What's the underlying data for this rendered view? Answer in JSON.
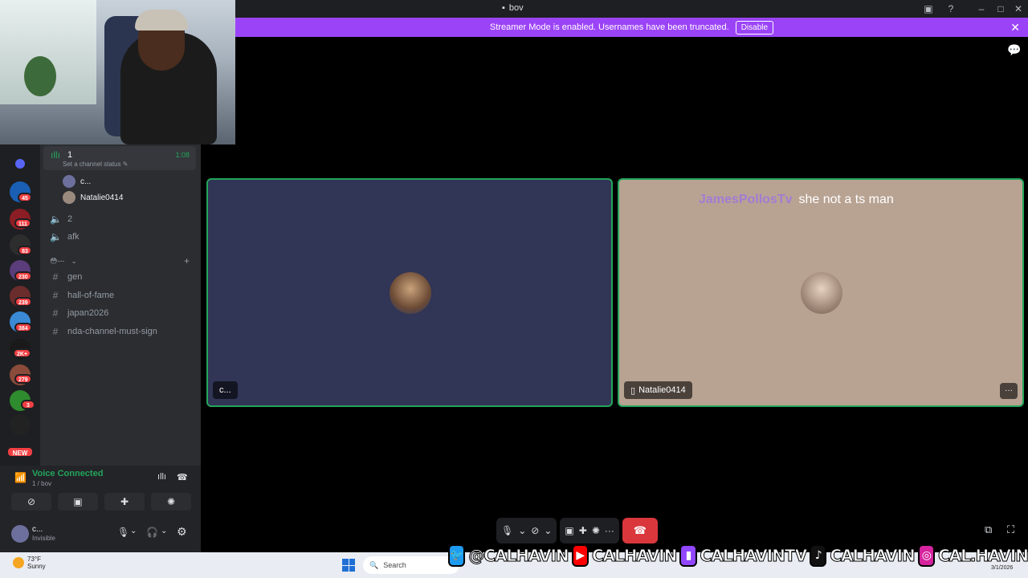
{
  "window": {
    "title": "bov"
  },
  "banner": {
    "text": "Streamer Mode is enabled. Usernames have been truncated.",
    "button": "Disable"
  },
  "rail": {
    "badges": [
      "45",
      "111",
      "83",
      "230",
      "239",
      "384",
      "2K+",
      "279",
      "3"
    ],
    "new_label": "NEW"
  },
  "channels": {
    "active_voice": {
      "name": "1",
      "timer": "1:08",
      "status_placeholder": "Set a channel status"
    },
    "members": [
      "c...",
      "Natalie0414"
    ],
    "voice2": "2",
    "afk": "afk",
    "category": "😳---",
    "text_channels": [
      "gen",
      "hall-of-fame",
      "japan2026",
      "nda-channel-must-sign"
    ]
  },
  "voice_panel": {
    "status": "Voice Connected",
    "sub": "1 / bov"
  },
  "user": {
    "name": "c...",
    "status": "Invisible"
  },
  "tiles": {
    "left_name": "c...",
    "right_name": "Natalie0414"
  },
  "chat_overlay": {
    "user": "JamesPollosTv",
    "message": "she not a ts man"
  },
  "taskbar": {
    "temp": "73°F",
    "weather": "Sunny",
    "search": "Search",
    "date": "3/1/2026"
  },
  "social": {
    "twitter": "@CALHAVIN",
    "youtube": "CALHAVIN",
    "twitch": "CALHAVINTV",
    "tiktok": "CALHAVIN",
    "instagram": "CAL.HAVIN"
  },
  "colors": {
    "accent_green": "#23a55a",
    "banner_purple": "#9b44f7",
    "hangup_red": "#da373c"
  }
}
